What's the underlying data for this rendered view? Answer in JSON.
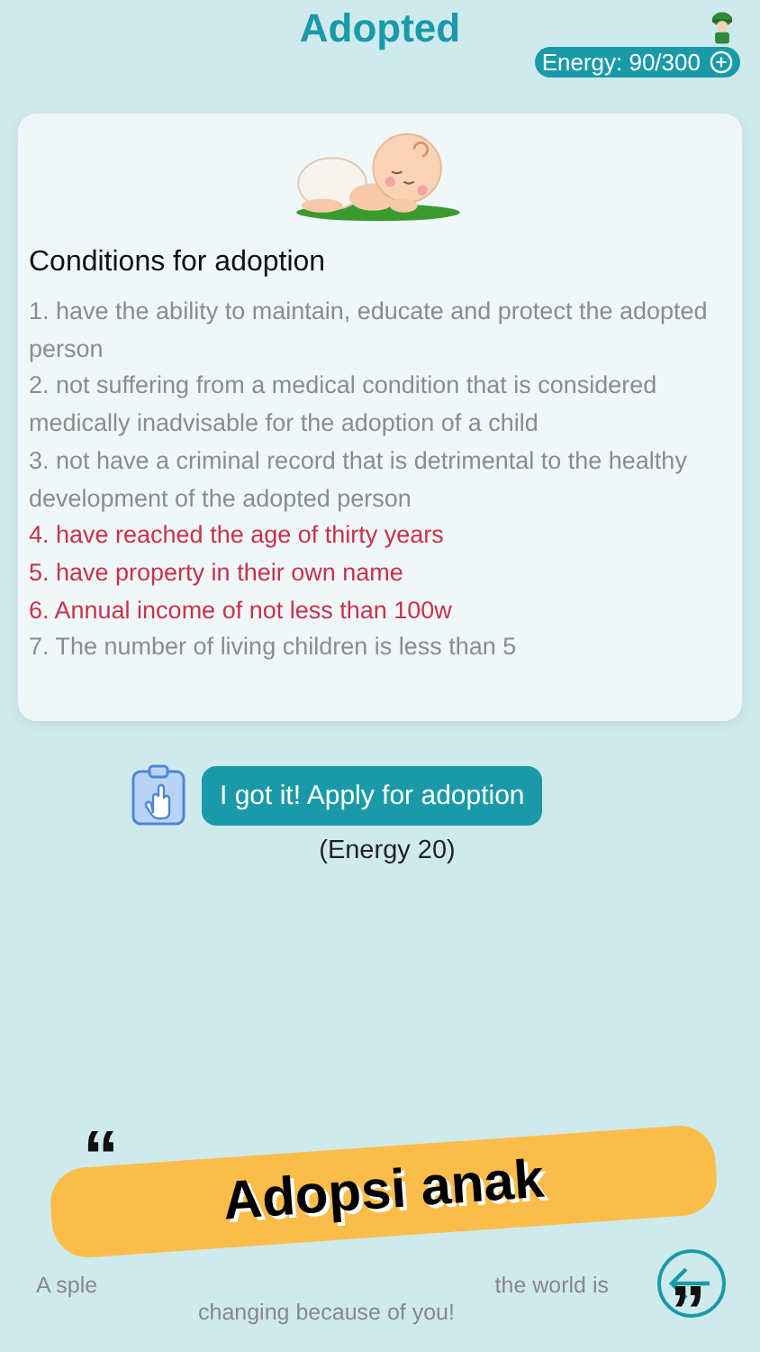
{
  "header": {
    "title": "Adopted",
    "energy": "Energy: 90/300"
  },
  "card": {
    "heading": "Conditions for adoption",
    "conditions": [
      {
        "text": "1. have the ability to maintain, educate and protect the adopted person",
        "met": true
      },
      {
        "text": "2. not suffering from a medical condition that is considered medically inadvisable for the adoption of a child",
        "met": true
      },
      {
        "text": "3. not have a criminal record that is detrimental to the healthy development of the adopted person",
        "met": true
      },
      {
        "text": "4. have reached the age of thirty years",
        "met": false
      },
      {
        "text": "5. have property in their own name",
        "met": false
      },
      {
        "text": "6. Annual income of not less than 100w",
        "met": false
      },
      {
        "text": "7. The number of living children is less than 5",
        "met": true
      }
    ]
  },
  "apply": {
    "button": "I got it! Apply for adoption",
    "cost": "(Energy 20)"
  },
  "quote": {
    "open_mark": "“",
    "line_1_start": "A sple",
    "line_1_end": "the world is",
    "line_2": "changing because of you!",
    "close_mark": "”"
  },
  "banner": {
    "text": "Adopsi anak"
  }
}
